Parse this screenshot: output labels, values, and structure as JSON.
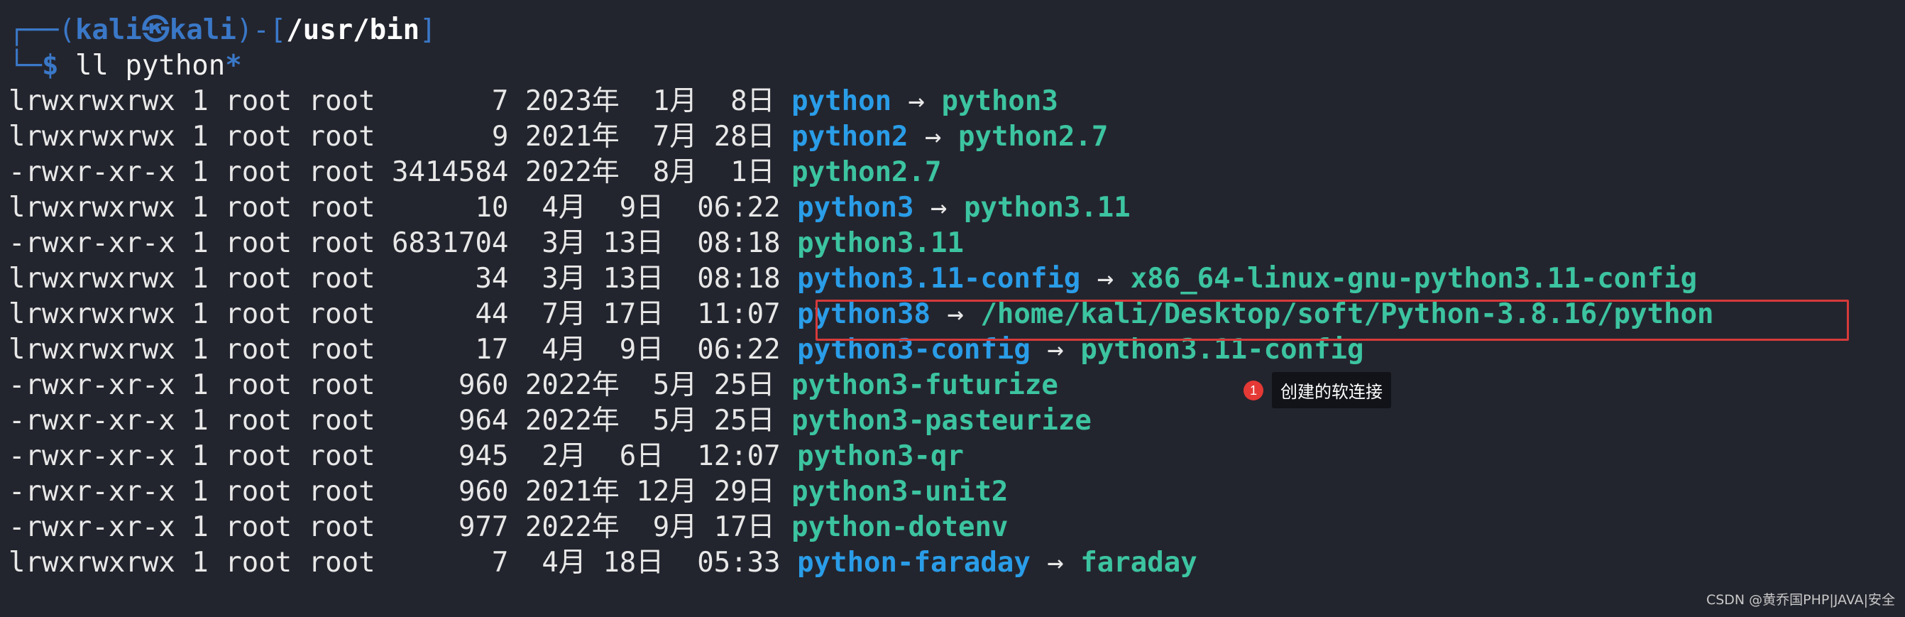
{
  "prompt": {
    "corner_top": "┌──",
    "user": "kali",
    "separator_glyph": "㉿",
    "host": "kali",
    "dash": "-",
    "path": "/usr/bin",
    "corner_bottom": "└─",
    "dollar": "$",
    "command": "ll",
    "arg": "python",
    "glob": "*"
  },
  "listing": [
    {
      "meta": "lrwxrwxrwx 1 root root       7 2023年  1月  8日 ",
      "name": "python",
      "kind": "link",
      "target": "python3"
    },
    {
      "meta": "lrwxrwxrwx 1 root root       9 2021年  7月 28日 ",
      "name": "python2",
      "kind": "link",
      "target": "python2.7"
    },
    {
      "meta": "-rwxr-xr-x 1 root root 3414584 2022年  8月  1日 ",
      "name": "python2.7",
      "kind": "exec",
      "target": ""
    },
    {
      "meta": "lrwxrwxrwx 1 root root      10  4月  9日  06:22 ",
      "name": "python3",
      "kind": "link",
      "target": "python3.11"
    },
    {
      "meta": "-rwxr-xr-x 1 root root 6831704  3月 13日  08:18 ",
      "name": "python3.11",
      "kind": "exec",
      "target": ""
    },
    {
      "meta": "lrwxrwxrwx 1 root root      34  3月 13日  08:18 ",
      "name": "python3.11-config",
      "kind": "link",
      "target": "x86_64-linux-gnu-python3.11-config"
    },
    {
      "meta": "lrwxrwxrwx 1 root root      44  7月 17日  11:07 ",
      "name": "python38",
      "kind": "link",
      "target": "/home/kali/Desktop/soft/Python-3.8.16/python"
    },
    {
      "meta": "lrwxrwxrwx 1 root root      17  4月  9日  06:22 ",
      "name": "python3-config",
      "kind": "link",
      "target": "python3.11-config"
    },
    {
      "meta": "-rwxr-xr-x 1 root root     960 2022年  5月 25日 ",
      "name": "python3-futurize",
      "kind": "exec",
      "target": ""
    },
    {
      "meta": "-rwxr-xr-x 1 root root     964 2022年  5月 25日 ",
      "name": "python3-pasteurize",
      "kind": "exec",
      "target": ""
    },
    {
      "meta": "-rwxr-xr-x 1 root root     945  2月  6日  12:07 ",
      "name": "python3-qr",
      "kind": "exec",
      "target": ""
    },
    {
      "meta": "-rwxr-xr-x 1 root root     960 2021年 12月 29日 ",
      "name": "python3-unit2",
      "kind": "exec",
      "target": ""
    },
    {
      "meta": "-rwxr-xr-x 1 root root     977 2022年  9月 17日 ",
      "name": "python-dotenv",
      "kind": "exec",
      "target": ""
    },
    {
      "meta": "lrwxrwxrwx 1 root root       7  4月 18日  05:33 ",
      "name": "python-faraday",
      "kind": "link",
      "target": "faraday"
    }
  ],
  "arrow": " → ",
  "annotation": {
    "badge": "1",
    "label": "创建的软连接"
  },
  "watermark": "CSDN @黄乔国PHP|JAVA|安全"
}
